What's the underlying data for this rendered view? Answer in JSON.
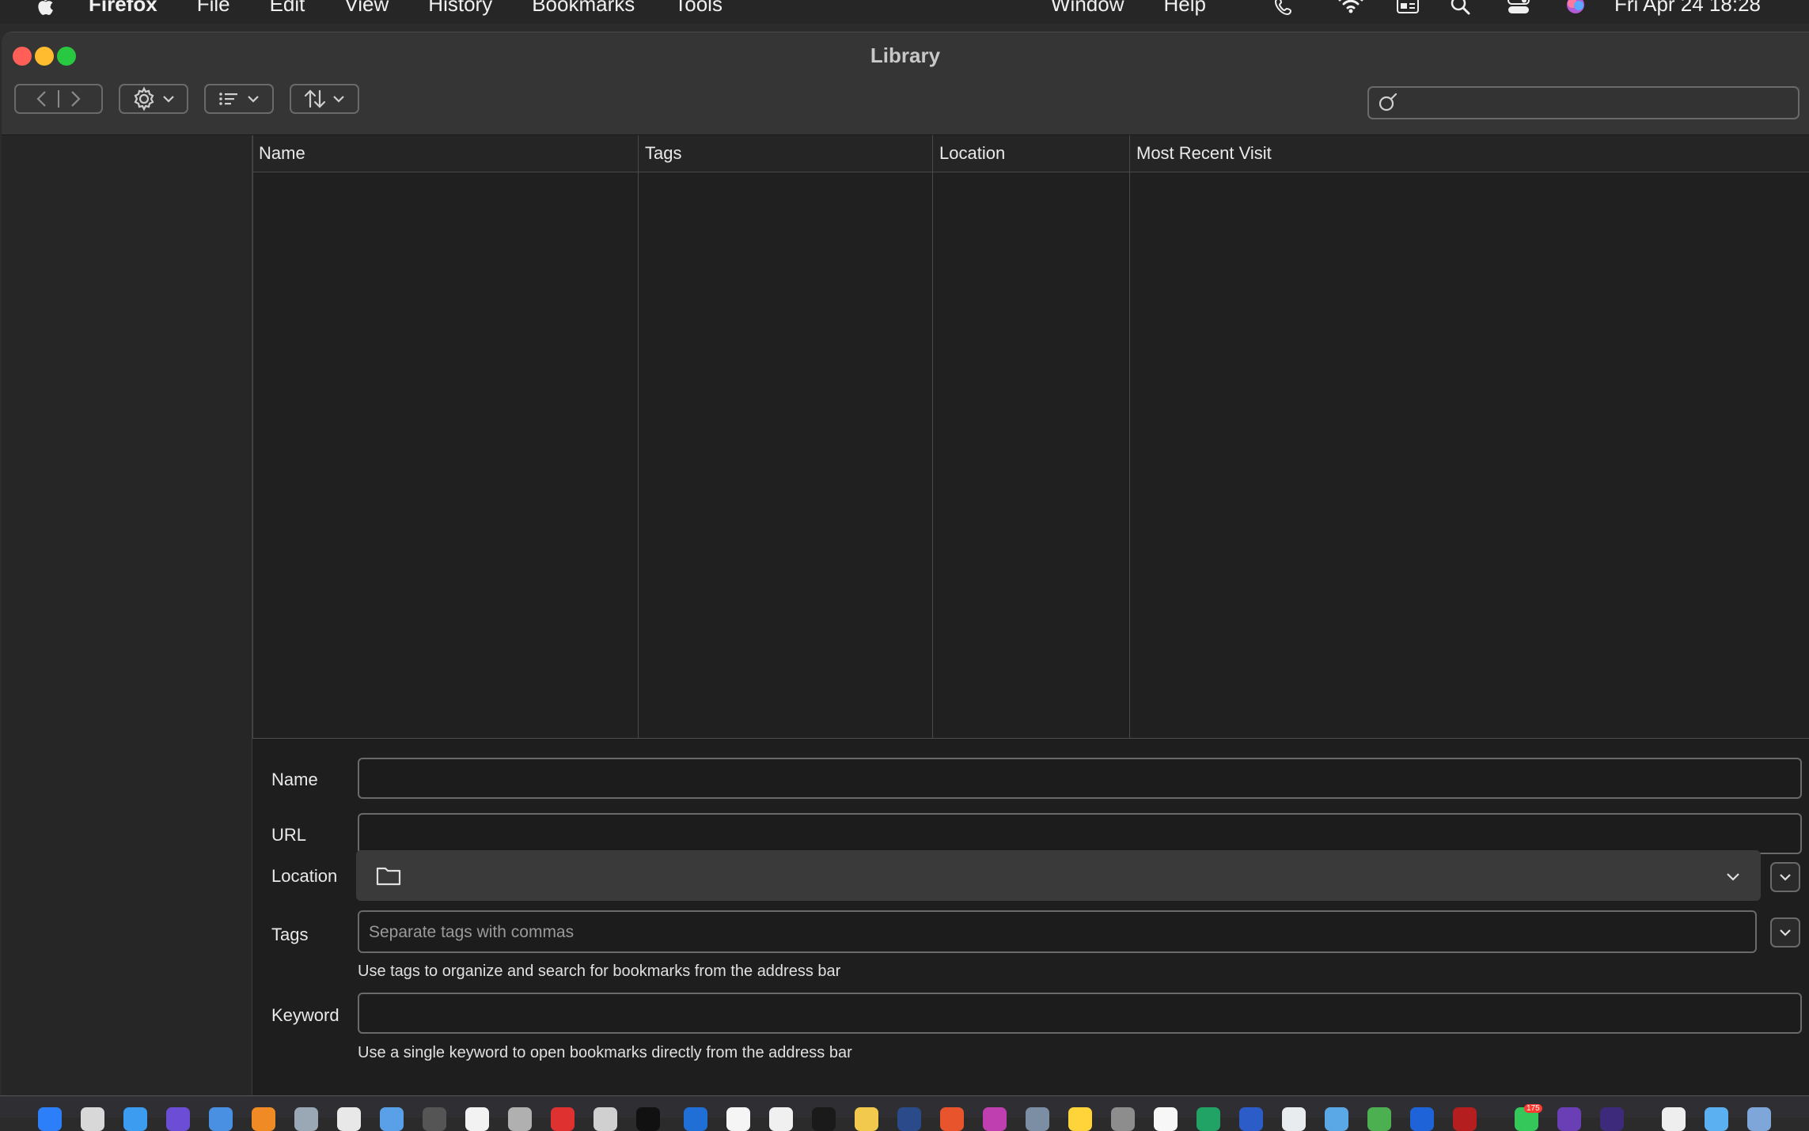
{
  "menubar": {
    "app_name": "Firefox",
    "menus": [
      "File",
      "Edit",
      "View",
      "History",
      "Bookmarks",
      "Tools"
    ],
    "right_menus": [
      "Window",
      "Help"
    ],
    "clock": "Fri Apr 24  18:28",
    "status_icons": [
      "phone-icon",
      "wifi-icon",
      "keyboard-input-icon",
      "spotlight-search-icon",
      "control-center-icon",
      "siri-icon"
    ]
  },
  "window": {
    "title": "Library",
    "traffic_lights": {
      "close": "#ff5f57",
      "minimize": "#febc2e",
      "zoom": "#28c840"
    }
  },
  "toolbar": {
    "back_icon": "chevron-left-icon",
    "forward_icon": "chevron-right-icon",
    "organize_icon": "gear-icon",
    "views_icon": "list-icon",
    "sort_icon": "sort-arrows-icon",
    "search_value": "",
    "search_placeholder": ""
  },
  "table": {
    "columns": [
      "Name",
      "Tags",
      "Location",
      "Most Recent Visit"
    ],
    "rows": []
  },
  "details": {
    "name_label": "Name",
    "name_value": "",
    "url_label": "URL",
    "url_value": "",
    "location_label": "Location",
    "location_value": "",
    "tags_label": "Tags",
    "tags_placeholder": "Separate tags with commas",
    "tags_hint": "Use tags to organize and search for bookmarks from the address bar",
    "keyword_label": "Keyword",
    "keyword_value": "",
    "keyword_hint": "Use a single keyword to open bookmarks directly from the address bar"
  },
  "dock": {
    "badge": "175"
  }
}
